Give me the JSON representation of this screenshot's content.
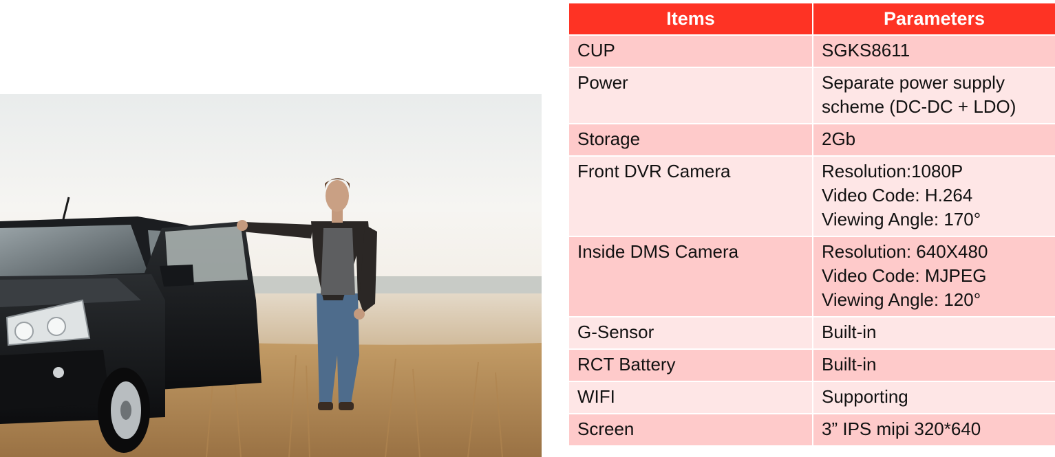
{
  "colors": {
    "header_bg": "#fe3324",
    "header_text": "#ffffff",
    "row_odd_bg": "#fecaca",
    "row_even_bg": "#fee6e6",
    "body_text": "#111111"
  },
  "photo": {
    "subject": "man-standing-beside-black-suv-in-dry-grass-field"
  },
  "table": {
    "headers": {
      "items": "Items",
      "parameters": "Parameters"
    },
    "rows": [
      {
        "item": "CUP",
        "params": [
          "SGKS8611"
        ]
      },
      {
        "item": "Power",
        "params": [
          "Separate power supply",
          "scheme (DC-DC + LDO)"
        ]
      },
      {
        "item": "Storage",
        "params": [
          "2Gb"
        ]
      },
      {
        "item": "Front DVR Camera",
        "params": [
          "Resolution:1080P",
          "Video Code: H.264",
          "Viewing Angle: 170°"
        ]
      },
      {
        "item": "Inside DMS Camera",
        "params": [
          "Resolution: 640X480",
          "Video Code: MJPEG",
          "Viewing Angle: 120°"
        ]
      },
      {
        "item": "G-Sensor",
        "params": [
          "Built-in"
        ]
      },
      {
        "item": "RCT Battery",
        "params": [
          "Built-in"
        ]
      },
      {
        "item": "WIFI",
        "params": [
          "Supporting"
        ]
      },
      {
        "item": "Screen",
        "params": [
          "3” IPS mipi 320*640"
        ]
      }
    ]
  }
}
